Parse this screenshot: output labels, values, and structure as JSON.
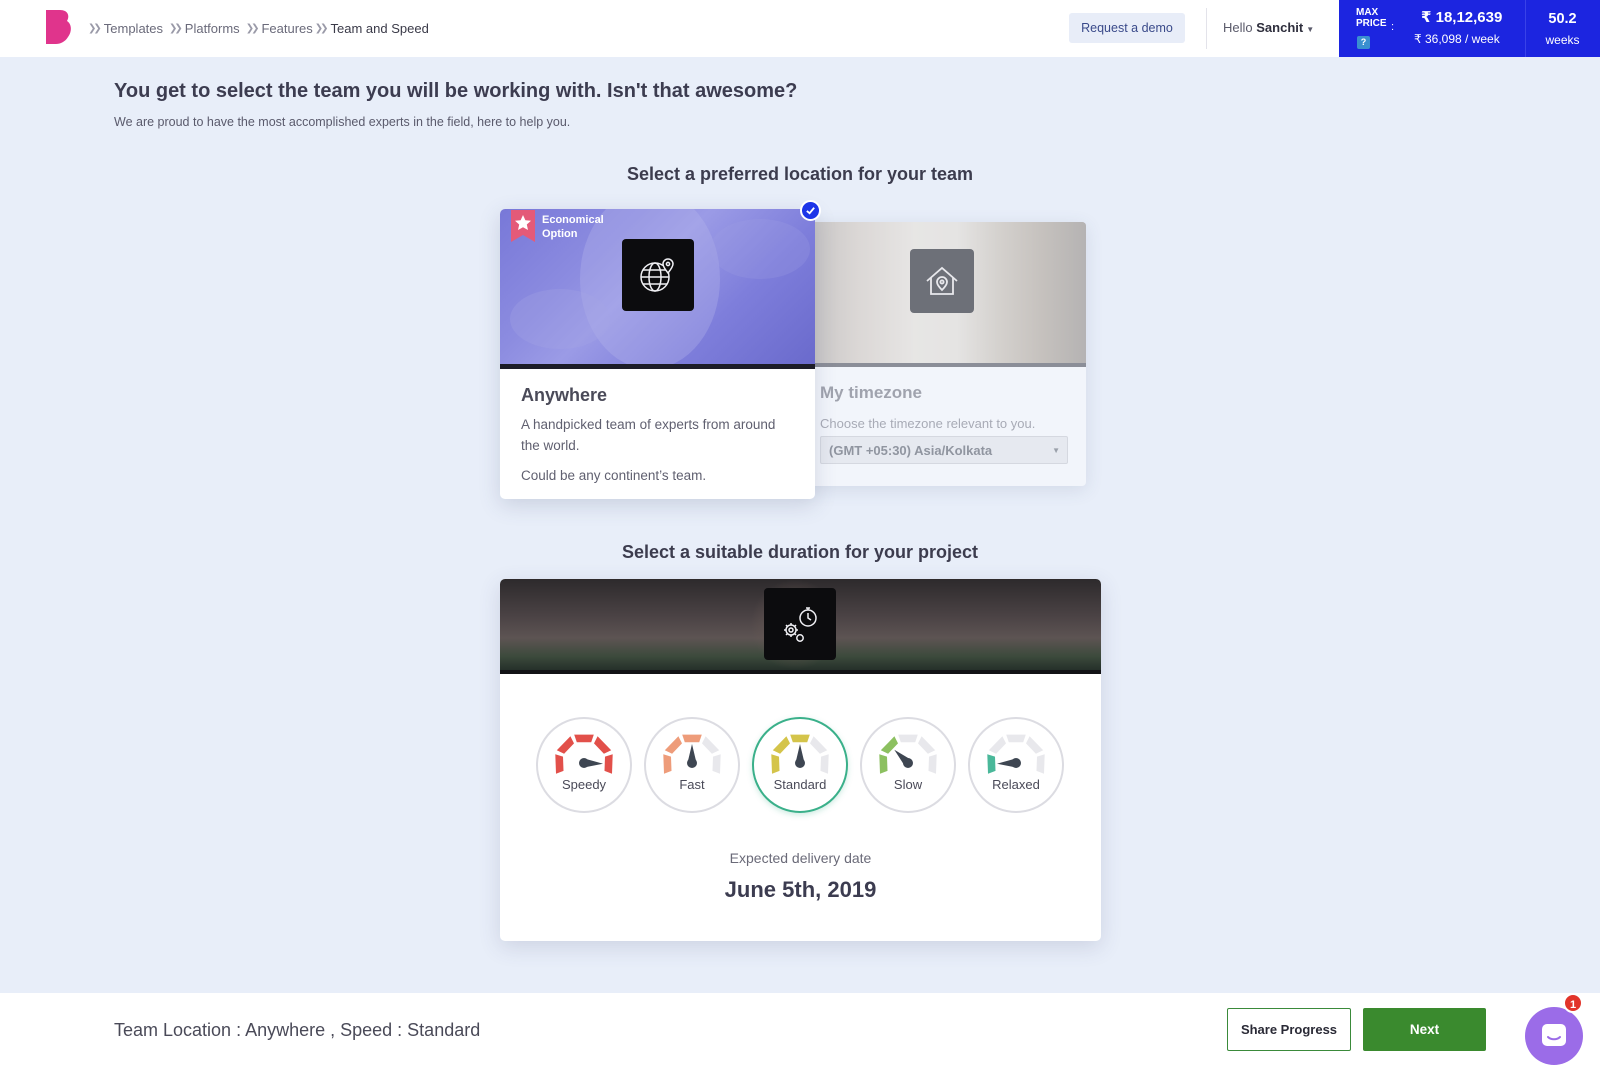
{
  "header": {
    "breadcrumb": [
      {
        "label": "Templates"
      },
      {
        "label": "Platforms"
      },
      {
        "label": "Features"
      },
      {
        "label": "Team and Speed"
      }
    ],
    "request_demo": "Request a demo",
    "hello": "Hello",
    "user_name": "Sanchit",
    "price": {
      "label_line1": "MAX",
      "label_line2": "PRICE",
      "colon": ":",
      "help": "?",
      "total": "₹ 18,12,639",
      "per_week": "₹ 36,098 / week",
      "weeks_value": "50.2",
      "weeks_label": "weeks"
    }
  },
  "intro": {
    "title": "You get to select the team you will be working with. Isn't that awesome?",
    "subtitle": "We are proud to have the most accomplished experts in the field, here to help you."
  },
  "location": {
    "section_title": "Select a preferred location for your team",
    "anywhere": {
      "badge_line1": "Economical",
      "badge_line2": "Option",
      "title": "Anywhere",
      "desc": "A handpicked team of experts from around the world.",
      "desc2": "Could be any continent’s team.",
      "selected": true
    },
    "timezone": {
      "title": "My timezone",
      "desc": "Choose the timezone relevant to you.",
      "select_value": "(GMT +05:30) Asia/Kolkata"
    }
  },
  "duration": {
    "section_title": "Select a suitable duration for your project",
    "options": [
      {
        "label": "Speedy",
        "level": 5,
        "color": "#e2504a"
      },
      {
        "label": "Fast",
        "level": 3,
        "color": "#ee9c7a"
      },
      {
        "label": "Standard",
        "level": 3,
        "color": "#d4c44a",
        "active": true
      },
      {
        "label": "Slow",
        "level": 2,
        "color": "#8cc060"
      },
      {
        "label": "Relaxed",
        "level": 1,
        "color": "#4ab89a"
      }
    ],
    "expected_label": "Expected delivery date",
    "expected_date": "June 5th, 2019"
  },
  "footer": {
    "summary": "Team Location : Anywhere , Speed : Standard",
    "share": "Share Progress",
    "next": "Next",
    "chat_badge": "1"
  },
  "colors": {
    "accent_blue": "#1c25e0",
    "brand_pink": "#e0348c",
    "next_green": "#3a8a2e"
  }
}
